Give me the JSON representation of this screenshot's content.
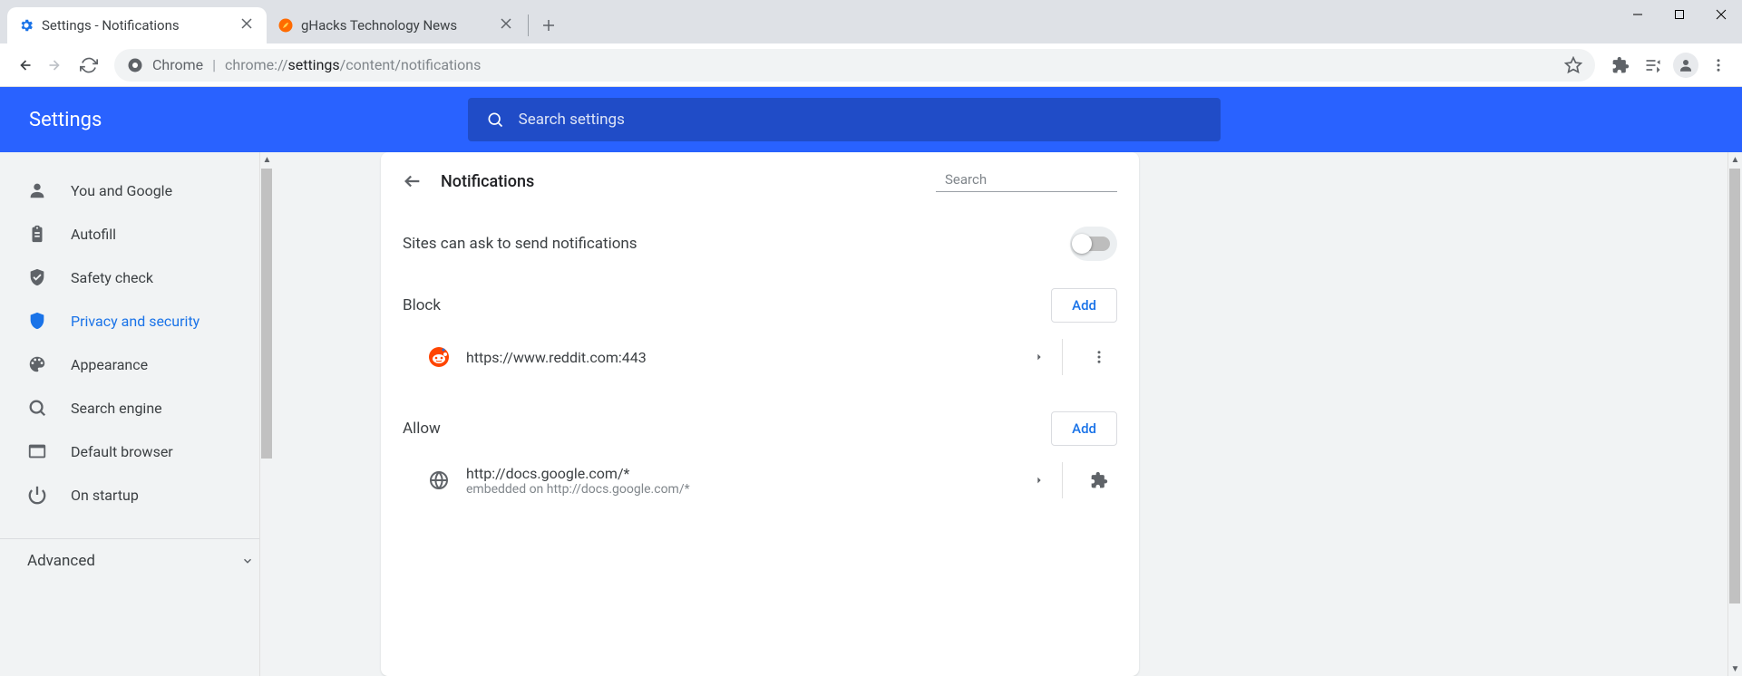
{
  "window": {
    "title": "Settings - Notifications"
  },
  "tabs": [
    {
      "title": "Settings - Notifications",
      "active": true
    },
    {
      "title": "gHacks Technology News",
      "active": false
    }
  ],
  "omnibox": {
    "scheme_label": "Chrome",
    "url_prefix": "chrome://",
    "url_bold": "settings",
    "url_suffix": "/content/notifications"
  },
  "header": {
    "title": "Settings",
    "search_placeholder": "Search settings"
  },
  "sidebar": {
    "items": [
      {
        "label": "You and Google"
      },
      {
        "label": "Autofill"
      },
      {
        "label": "Safety check"
      },
      {
        "label": "Privacy and security"
      },
      {
        "label": "Appearance"
      },
      {
        "label": "Search engine"
      },
      {
        "label": "Default browser"
      },
      {
        "label": "On startup"
      }
    ],
    "advanced_label": "Advanced"
  },
  "content": {
    "title": "Notifications",
    "search_placeholder": "Search",
    "ask_label": "Sites can ask to send notifications",
    "ask_enabled": false,
    "block_label": "Block",
    "block_add": "Add",
    "block_sites": [
      {
        "url": "https://www.reddit.com:443"
      }
    ],
    "allow_label": "Allow",
    "allow_add": "Add",
    "allow_sites": [
      {
        "url": "http://docs.google.com/*",
        "sub": "embedded on http://docs.google.com/*"
      }
    ]
  }
}
